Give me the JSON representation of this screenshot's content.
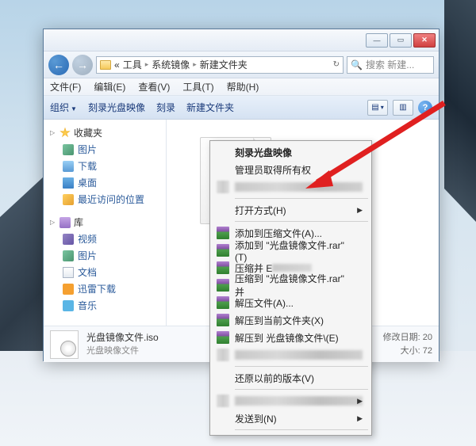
{
  "breadcrumb": {
    "part1": "工具",
    "part2": "系统镜像",
    "part3": "新建文件夹"
  },
  "search": {
    "placeholder": "搜索 新建..."
  },
  "menubar": {
    "file": "文件(F)",
    "edit": "编辑(E)",
    "view": "查看(V)",
    "tools": "工具(T)",
    "help": "帮助(H)"
  },
  "toolbar": {
    "organize": "组织",
    "burn_image": "刻录光盘映像",
    "burn": "刻录",
    "new_folder": "新建文件夹"
  },
  "sidebar": {
    "favorites": {
      "label": "收藏夹",
      "items": [
        "图片",
        "下载",
        "桌面",
        "最近访问的位置"
      ]
    },
    "libraries": {
      "label": "库",
      "items": [
        "视频",
        "图片",
        "文档",
        "迅雷下载",
        "音乐"
      ]
    }
  },
  "details": {
    "filename": "光盘镜像文件.iso",
    "filetype": "光盘映像文件",
    "moddate_label": "修改日期:",
    "moddate_value": "20",
    "size_label": "大小:",
    "size_value": "72"
  },
  "context_menu": {
    "burn_image": "刻录光盘映像",
    "admin_owner": "管理员取得所有权",
    "open_with": "打开方式(H)",
    "add_archive": "添加到压缩文件(A)...",
    "add_rar": "添加到 \"光盘镜像文件.rar\"(T)",
    "compress_email_prefix": "压缩并 E",
    "compress_to_email": "压缩到 \"光盘镜像文件.rar\" 并",
    "extract": "解压文件(A)...",
    "extract_here": "解压到当前文件夹(X)",
    "extract_to": "解压到 光盘镜像文件\\(E)",
    "restore": "还原以前的版本(V)",
    "send_to": "发送到(N)"
  }
}
